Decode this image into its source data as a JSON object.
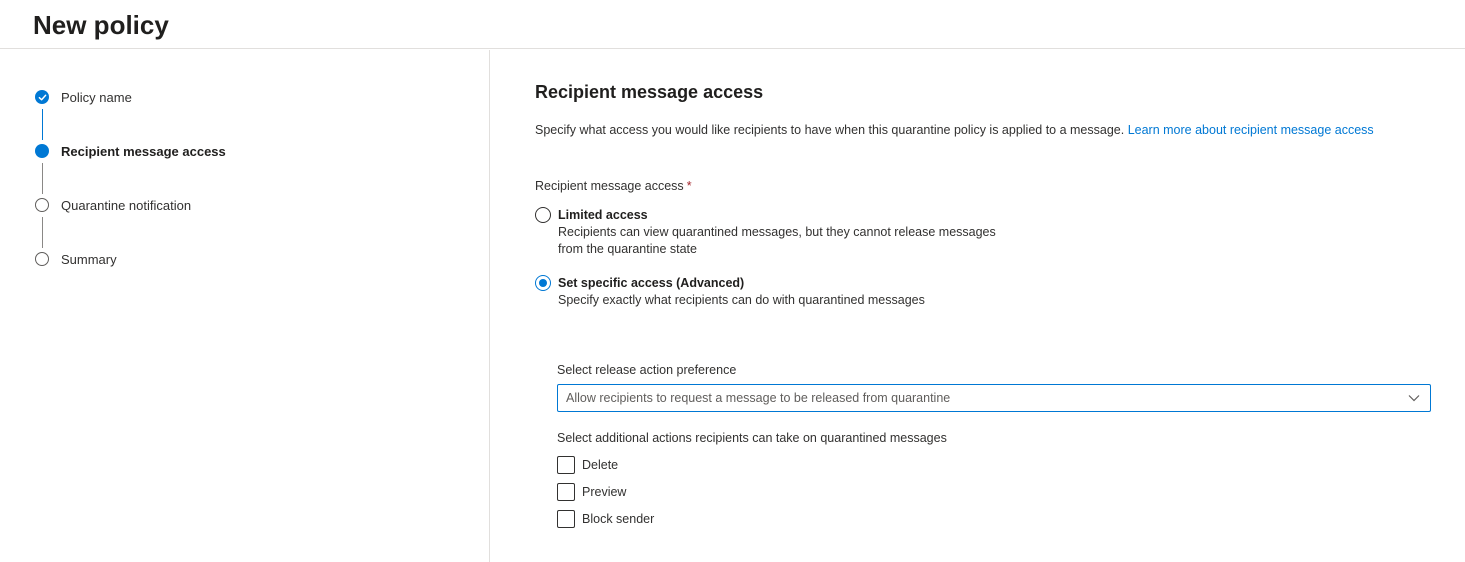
{
  "page_title": "New policy",
  "steps": [
    {
      "label": "Policy name",
      "state": "done"
    },
    {
      "label": "Recipient message access",
      "state": "current"
    },
    {
      "label": "Quarantine notification",
      "state": "todo"
    },
    {
      "label": "Summary",
      "state": "todo"
    }
  ],
  "section": {
    "title": "Recipient message access",
    "description": "Specify what access you would like recipients to have when this quarantine policy is applied to a message.",
    "learn_more_link": "Learn more about recipient message access"
  },
  "access_field": {
    "label": "Recipient message access",
    "required_mark": "*",
    "options": [
      {
        "title": "Limited access",
        "description": "Recipients can view quarantined messages, but they cannot release messages from the quarantine state",
        "selected": false
      },
      {
        "title": "Set specific access (Advanced)",
        "description": "Specify exactly what recipients can do with quarantined messages",
        "selected": true
      }
    ]
  },
  "release_preference": {
    "label": "Select release action preference",
    "value": "Allow recipients to request a message to be released from quarantine"
  },
  "additional_actions": {
    "label": "Select additional actions recipients can take on quarantined messages",
    "items": [
      {
        "label": "Delete",
        "checked": false
      },
      {
        "label": "Preview",
        "checked": false
      },
      {
        "label": "Block sender",
        "checked": false
      }
    ]
  },
  "colors": {
    "accent": "#0078d4",
    "required": "#a4262c",
    "text": "#323130"
  },
  "icons": {
    "step_done": "checkmark-icon",
    "dropdown": "chevron-down-icon"
  }
}
